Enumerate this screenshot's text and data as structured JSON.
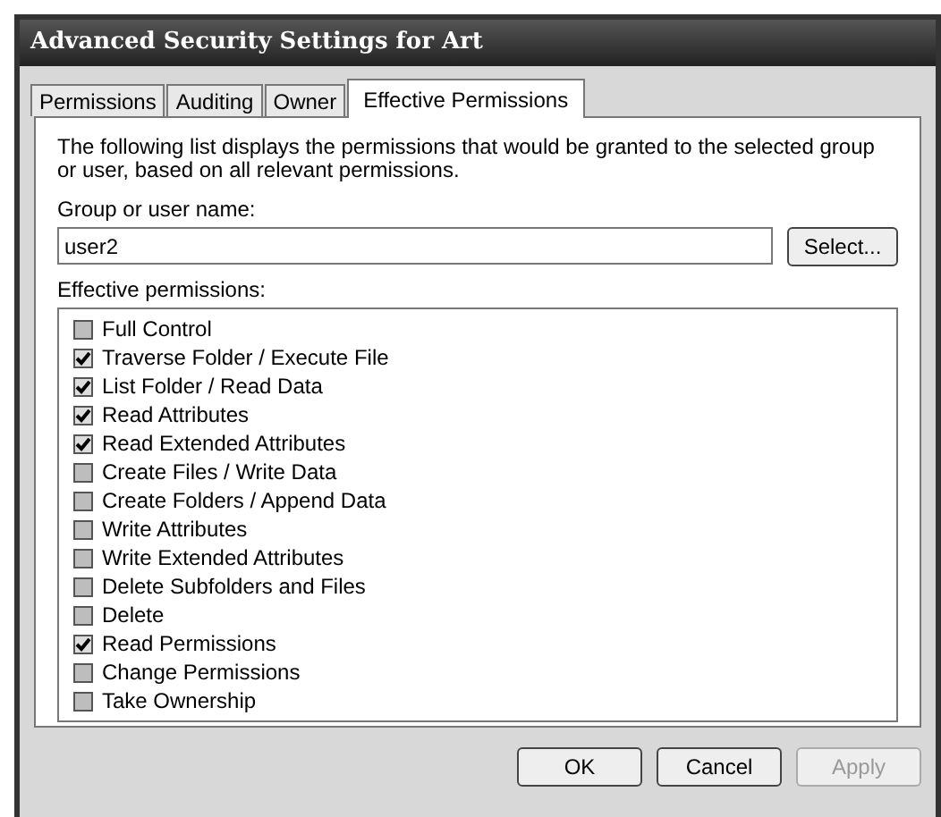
{
  "window": {
    "title": "Advanced Security Settings for Art"
  },
  "tabs": [
    {
      "label": "Permissions",
      "selected": false
    },
    {
      "label": "Auditing",
      "selected": false
    },
    {
      "label": "Owner",
      "selected": false
    },
    {
      "label": "Effective Permissions",
      "selected": true
    }
  ],
  "description": "The following list displays the permissions that would be granted to the selected group or user, based on all relevant permissions.",
  "group_field": {
    "label": "Group or user name:",
    "value": "user2",
    "button": "Select..."
  },
  "permissions_label": "Effective permissions:",
  "permissions": [
    {
      "label": "Full Control",
      "checked": false
    },
    {
      "label": "Traverse Folder / Execute File",
      "checked": true
    },
    {
      "label": "List Folder / Read Data",
      "checked": true
    },
    {
      "label": "Read Attributes",
      "checked": true
    },
    {
      "label": "Read Extended Attributes",
      "checked": true
    },
    {
      "label": "Create Files / Write Data",
      "checked": false
    },
    {
      "label": "Create Folders / Append Data",
      "checked": false
    },
    {
      "label": "Write Attributes",
      "checked": false
    },
    {
      "label": "Write Extended Attributes",
      "checked": false
    },
    {
      "label": "Delete Subfolders and Files",
      "checked": false
    },
    {
      "label": "Delete",
      "checked": false
    },
    {
      "label": "Read Permissions",
      "checked": true
    },
    {
      "label": "Change Permissions",
      "checked": false
    },
    {
      "label": "Take Ownership",
      "checked": false
    }
  ],
  "buttons": [
    {
      "label": "OK",
      "disabled": false
    },
    {
      "label": "Cancel",
      "disabled": false
    },
    {
      "label": "Apply",
      "disabled": true
    }
  ]
}
